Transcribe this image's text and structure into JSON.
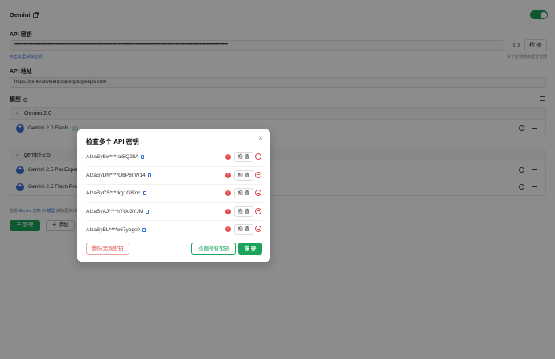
{
  "provider": {
    "title": "Gemini",
    "enabled": true
  },
  "api_key": {
    "label": "API 密钥",
    "value": "••••••••••••••••••••••••••••••••••••••••••••••••••••••••••••••••••••••••••••••••••••••••••••••••••••••••••••••••••••••••••••••••••••••••••••••••••••••••••••••••••••••",
    "check_label": "检 查",
    "link_text": "点击这里获取密钥",
    "hint_text": "多个密钥使用逗号分隔"
  },
  "api_url": {
    "label": "API 地址",
    "value": "https://generativelanguage.googleapis.com"
  },
  "models": {
    "label": "模型",
    "groups": [
      {
        "name": "Gemini 2.0",
        "items": [
          {
            "name": "Gemini 2.0 Flash"
          }
        ]
      },
      {
        "name": "gemini-2.5",
        "items": [
          {
            "name": "Gemini 2.5 Pro Experimental"
          },
          {
            "name": "Gemini 2.5 Flash Preview"
          }
        ]
      }
    ]
  },
  "footer": {
    "prefix": "查看",
    "doc_link": "Gemini 文档",
    "and": "和",
    "models_link": "模型",
    "suffix": "获取更多详情"
  },
  "buttons": {
    "manage": "管理",
    "add": "添加"
  },
  "modal": {
    "title": "检查多个 API 密钥",
    "close": "×",
    "keys": [
      {
        "key": "AIzaSyBw****aiSQ2lIA",
        "status": "error",
        "check_label": "检 查"
      },
      {
        "key": "AIzaSyDN****O8P8nW14",
        "status": "error",
        "check_label": "检 查"
      },
      {
        "key": "AIzaSyCS****kg1G8foc",
        "status": "error",
        "check_label": "检 查"
      },
      {
        "key": "AIzaSyAJ****hYUo3YJM",
        "status": "error",
        "check_label": "检 查"
      },
      {
        "key": "AIzaSyBL****o67yogs0",
        "status": "error",
        "check_label": "检 查"
      }
    ],
    "delete_invalid": "删除无效密钥",
    "check_all": "检查所有密钥",
    "save": "保 存"
  },
  "colors": {
    "accent": "#1aa35a",
    "error": "#e04b4b",
    "link": "#2b6fd6"
  }
}
